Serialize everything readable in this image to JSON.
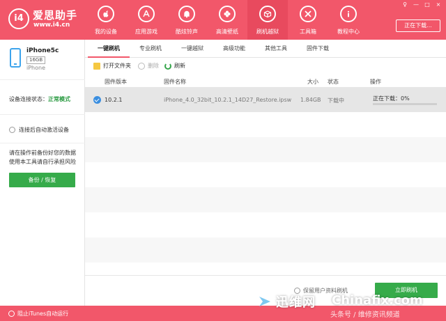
{
  "app": {
    "logo_mark": "i4",
    "logo_title": "爱思助手",
    "logo_url": "www.i4.cn"
  },
  "nav": [
    {
      "label": "我的设备",
      "icon": "apple-icon"
    },
    {
      "label": "应用游戏",
      "icon": "app-store-icon"
    },
    {
      "label": "酷炫铃声",
      "icon": "bell-icon"
    },
    {
      "label": "高清壁纸",
      "icon": "flower-icon"
    },
    {
      "label": "刷机越狱",
      "icon": "box-icon"
    },
    {
      "label": "工具箱",
      "icon": "tools-icon"
    },
    {
      "label": "教程中心",
      "icon": "info-icon"
    }
  ],
  "window": {
    "controls": [
      "♀",
      "—",
      "□",
      "×"
    ],
    "download_status": "正在下载..."
  },
  "device": {
    "name": "iPhone5c",
    "capacity": "16GB",
    "type": "iPhone"
  },
  "sidebar": {
    "conn_label": "设备连接状态：",
    "conn_value": "正常模式",
    "auto_activate": "连接后自动激活设备",
    "warning": "请在操作前备份好您的数据 使用本工具请自行承担风险",
    "backup_button": "备份 / 恢复"
  },
  "tabs": [
    "一键刷机",
    "专业刷机",
    "一键越狱",
    "高级功能",
    "其他工具",
    "固件下载"
  ],
  "toolbar": {
    "open_folder": "打开文件夹",
    "delete": "删除",
    "refresh": "刷新"
  },
  "table": {
    "columns": [
      "固件版本",
      "固件名称",
      "大小",
      "状态",
      "操作"
    ],
    "rows": [
      {
        "version": "10.2.1",
        "name": "iPhone_4.0_32bit_10.2.1_14D27_Restore.ipsw",
        "size": "1.84GB",
        "status": "下载中",
        "action": "正在下载：0%",
        "progress": 0
      }
    ]
  },
  "footer": {
    "keep_data": "保留用户资料刷机",
    "flash_button": "立即刷机"
  },
  "statusbar": {
    "itunes_toggle": "阻止iTunes自动运行"
  },
  "watermark": {
    "cn": "迅维网",
    "en": "Chinafix.com",
    "sub": "头条号 / 维修资讯频道"
  },
  "colors": {
    "brand": "#f2576a",
    "green": "#36ab4a",
    "blue": "#3b8fe0"
  }
}
